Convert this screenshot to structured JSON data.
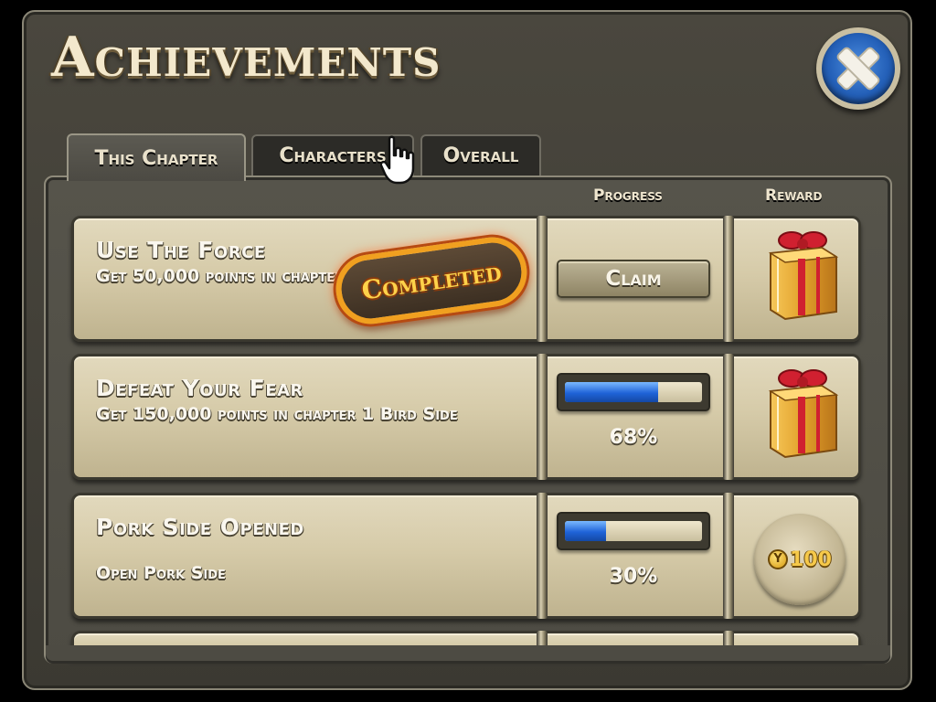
{
  "title": "Achievements",
  "tabs": [
    {
      "label": "This Chapter",
      "active": true
    },
    {
      "label": "Characters",
      "active": false
    },
    {
      "label": "Overall",
      "active": false
    }
  ],
  "columns": {
    "progress": "Progress",
    "reward": "Reward"
  },
  "achievements": [
    {
      "title": "Use The Force",
      "description": "Get 50,000 points in chapter 1 Bird Side",
      "status": "Completed",
      "action_label": "Claim",
      "reward_icon": "gift-icon"
    },
    {
      "title": "Defeat Your Fear",
      "description": "Get 150,000 points in chapter 1 Bird Side",
      "progress_percent": 68,
      "progress_label": "68%",
      "reward_icon": "gift-icon"
    },
    {
      "title": "Pork Side Opened",
      "description": "Open Pork Side",
      "progress_percent": 30,
      "progress_label": "30%",
      "reward_icon": "coin-icon",
      "reward_value": "100"
    }
  ],
  "icons": {
    "close": "close-icon",
    "cursor": "hand-pointer-icon"
  },
  "colors": {
    "accent_blue": "#2460b8",
    "completed_orange": "#f0a020",
    "progress_blue": "#1f63d8"
  }
}
